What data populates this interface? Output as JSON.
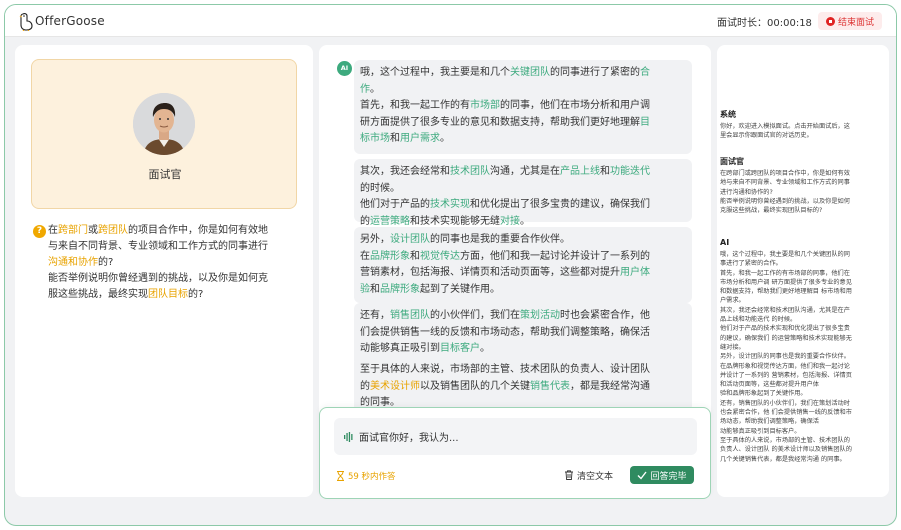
{
  "header": {
    "logo_text": "OfferGoose",
    "timer_label": "面试时长：",
    "timer_value": "00:00:18",
    "end_button": "结束面试"
  },
  "interviewer": {
    "label": "面试官"
  },
  "question": {
    "icon": "question-icon",
    "lines": [
      [
        {
          "t": "在"
        },
        {
          "t": "跨部门",
          "c": "o"
        },
        {
          "t": "或"
        },
        {
          "t": "跨团队",
          "c": "o"
        },
        {
          "t": "的项目合作中，你是如何有效地"
        }
      ],
      [
        {
          "t": "与来自不同背景、专业领域和工作方式的同事进行"
        }
      ],
      [
        {
          "t": "沟通和协作",
          "c": "o"
        },
        {
          "t": "的?"
        }
      ],
      [
        {
          "t": "能否举例说明你曾经遇到的挑战，以及你是如何克"
        }
      ],
      [
        {
          "t": "服这些挑战，最终实现"
        },
        {
          "t": "团队目标",
          "c": "o"
        },
        {
          "t": "的?"
        }
      ]
    ]
  },
  "conversation": {
    "ai_badge": "AI",
    "messages": [
      [
        [
          {
            "t": "哦，这个过程中，我主要是和几个"
          },
          {
            "t": "关键团队",
            "c": "g"
          },
          {
            "t": "的同事进行了紧密的"
          },
          {
            "t": "合",
            "c": "g"
          }
        ],
        [
          {
            "t": "作",
            "c": "g"
          },
          {
            "t": "。"
          }
        ],
        [
          {
            "t": "首先，和我一起工作的有"
          },
          {
            "t": "市场部",
            "c": "g"
          },
          {
            "t": "的同事，他们在市场分析和用户调"
          }
        ],
        [
          {
            "t": "研方面提供了很多专业的意见和数据支持，帮助我们更好地理解"
          },
          {
            "t": "目",
            "c": "g"
          }
        ],
        [
          {
            "t": "标市场",
            "c": "g"
          },
          {
            "t": "和"
          },
          {
            "t": "用户需求",
            "c": "g"
          },
          {
            "t": "。"
          }
        ]
      ],
      [
        [
          {
            "t": "其次，我还会经常和"
          },
          {
            "t": "技术团队",
            "c": "g"
          },
          {
            "t": "沟通，尤其是在"
          },
          {
            "t": "产品上线",
            "c": "g"
          },
          {
            "t": "和"
          },
          {
            "t": "功能迭代",
            "c": "g"
          }
        ],
        [
          {
            "t": "的时候。"
          }
        ],
        [
          {
            "t": "他们对于产品的"
          },
          {
            "t": "技术实现",
            "c": "g"
          },
          {
            "t": "和优化提出了很多宝贵的建议，确保我们"
          }
        ],
        [
          {
            "t": "的"
          },
          {
            "t": "运营策略",
            "c": "g"
          },
          {
            "t": "和技术实现能够无缝"
          },
          {
            "t": "对接",
            "c": "g"
          },
          {
            "t": "。"
          }
        ]
      ],
      [
        [
          {
            "t": "另外，"
          },
          {
            "t": "设计团队",
            "c": "g"
          },
          {
            "t": "的同事也是我的重要合作伙伴。"
          }
        ],
        [
          {
            "t": "在"
          },
          {
            "t": "品牌形象",
            "c": "g"
          },
          {
            "t": "和"
          },
          {
            "t": "视觉传达",
            "c": "g"
          },
          {
            "t": "方面，他们和我一起讨论并设计了一系列的"
          }
        ],
        [
          {
            "t": "营销素材，包括海报、详情页和活动页面等，这些都对提升"
          },
          {
            "t": "用户体",
            "c": "g"
          }
        ],
        [
          {
            "t": "验",
            "c": "g"
          },
          {
            "t": "和"
          },
          {
            "t": "品牌形象",
            "c": "g"
          },
          {
            "t": "起到了关键作用。"
          }
        ]
      ],
      [
        [
          {
            "t": "还有，"
          },
          {
            "t": "销售团队",
            "c": "g"
          },
          {
            "t": "的小伙伴们，我们在"
          },
          {
            "t": "策划活动",
            "c": "g"
          },
          {
            "t": "时也会紧密合作，他"
          }
        ],
        [
          {
            "t": "们会提供销售一线的反馈和市场动态，帮助我们调整策略，确保活"
          }
        ],
        [
          {
            "t": "动能够真正吸引到"
          },
          {
            "t": "目标客户",
            "c": "g"
          },
          {
            "t": "。"
          }
        ]
      ],
      [
        [
          {
            "t": "至于具体的人来说，市场部的主管、技术团队的负责人、设计团队"
          }
        ],
        [
          {
            "t": "的"
          },
          {
            "t": "美术设计师",
            "c": "o"
          },
          {
            "t": "以及销售团队的几个关键"
          },
          {
            "t": "销售代表",
            "c": "g"
          },
          {
            "t": "，都是我经常沟通"
          }
        ],
        [
          {
            "t": "的同事。"
          }
        ]
      ]
    ]
  },
  "answer": {
    "placeholder": "面试官你好，我认为...",
    "countdown": "59 秒内作答",
    "clear_button": "清空文本",
    "done_button": "回答完毕"
  },
  "log": {
    "sections": [
      {
        "title": "系统",
        "lines": [
          "你好，欢迎进入模拟面试。点击开始面试后，这",
          "里会显示你跟面试官的对话历史。"
        ]
      },
      {
        "title": "面试官",
        "lines": [
          "在跨部门或跨团队的项目合作中，你是如何有效",
          "地与来自不同背景、专业领域和工作方式的同事",
          "进行沟通和协作的?",
          "能否举例说明你曾经遇到的挑战，以及你是如何",
          "克服这些挑战，最终实现团队目标的?"
        ]
      },
      {
        "title": "AI",
        "lines": [
          "哦，这个过程中，我主要是和几个关键团队的同",
          "事进行了紧密的合作。",
          "首先，和我一起工作的有市场部的同事，他们在",
          "市场分析和用户调 研方面提供了很多专业的意见",
          "和数据支持，帮助我们更好地理解目 标市场和用",
          "户需求。",
          "其次，我还会经常和技术团队沟通，尤其是在产",
          "品上线和功能迭代 的时候。",
          "他们对于产品的技术实现和优化提出了很多宝贵",
          "的建议，确保我们 的运营策略和技术实现能够无",
          "缝对接。",
          "另外，设计团队的同事也是我的重要合作伙伴。",
          "在品牌形象和视觉传达方面，他们和我一起讨论",
          "并设计了一系列的 营销素材，包括海报、详情页",
          "和活动页面等，这些都对提升用户体",
          "验和品牌形象起到了关键作用。",
          "还有，销售团队的小伙伴们，我们在策划活动时",
          "也会紧密合作，他 们会提供销售一线的反馈和市",
          "场动态，帮助我们调整策略，确保活",
          "动能够真正吸引到目标客户。",
          "至于具体的人来说，市场部的主管、技术团队的",
          "负责人、设计团队 的美术设计师以及销售团队的",
          "几个关键销售代表，都是我经常沟通 的同事。"
        ]
      }
    ]
  }
}
